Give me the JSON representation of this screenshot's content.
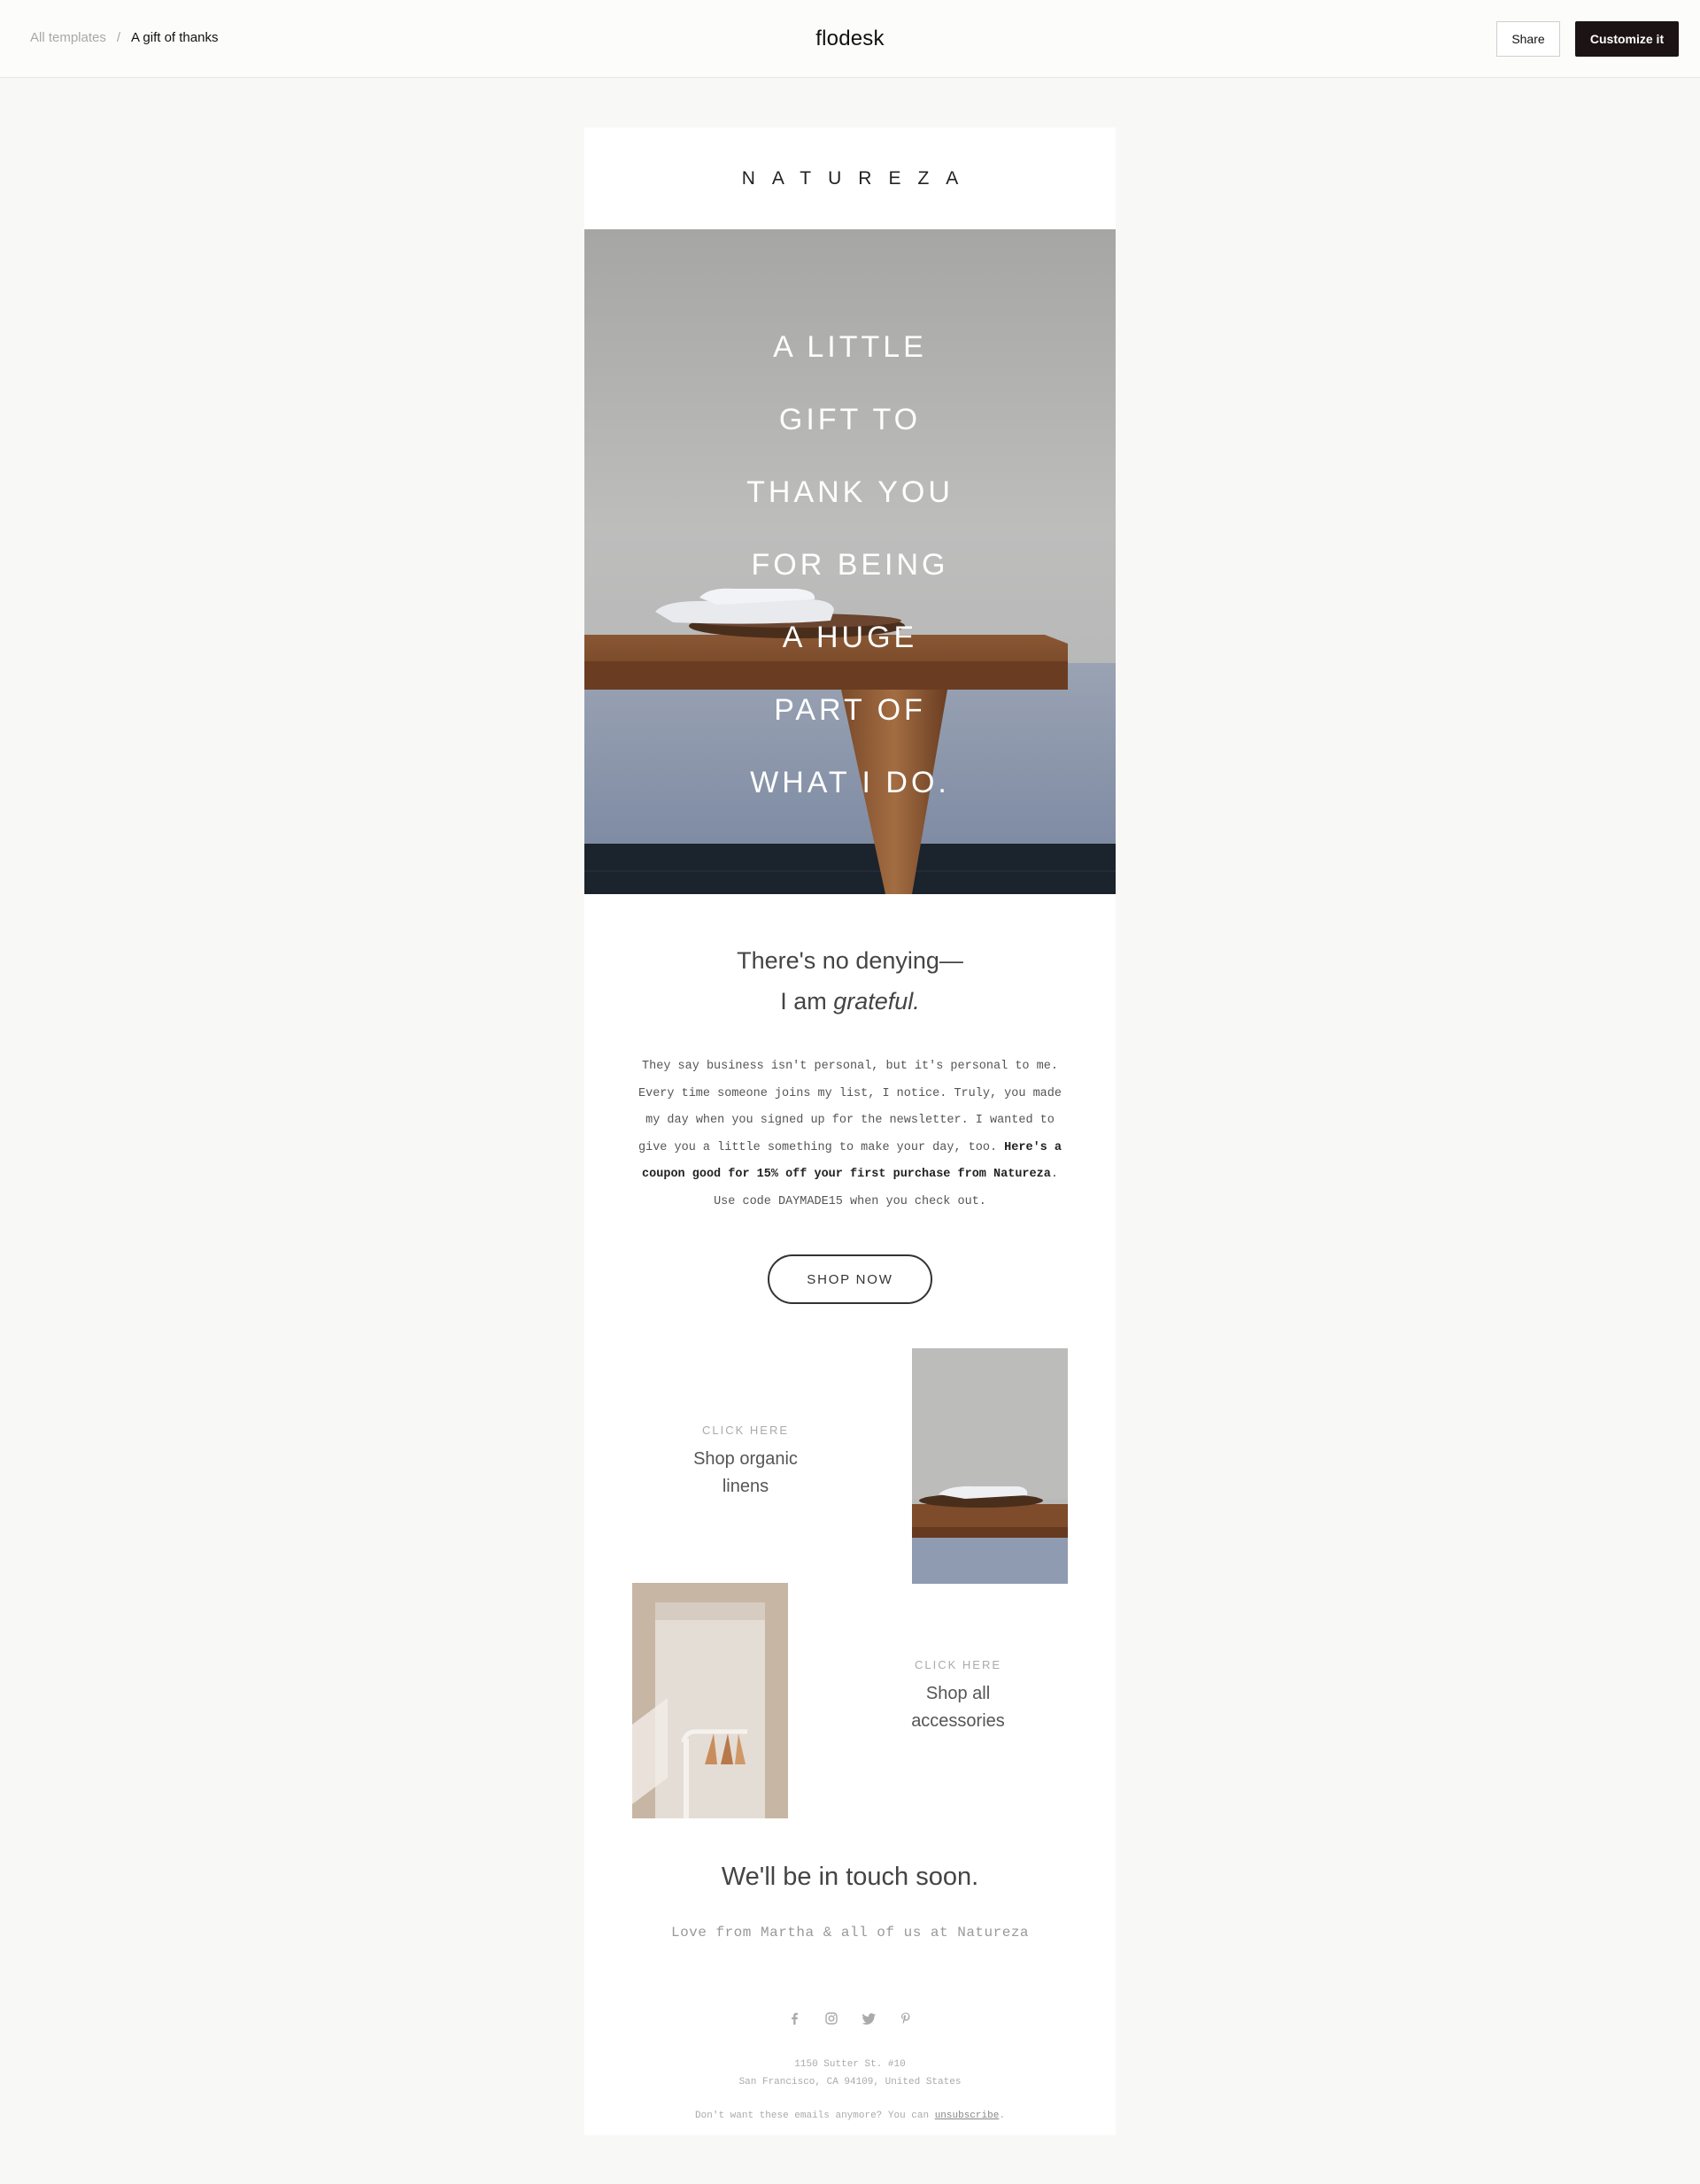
{
  "header": {
    "breadcrumb_root": "All templates",
    "breadcrumb_separator": "/",
    "breadcrumb_current": "A gift of thanks",
    "brand": "flodesk",
    "share_label": "Share",
    "customize_label": "Customize it"
  },
  "email": {
    "logo": "NATUREZA",
    "hero_lines": [
      "A LITTLE",
      "GIFT TO",
      "THANK YOU",
      "FOR BEING",
      "A HUGE",
      "PART OF",
      "WHAT I DO."
    ],
    "headline_line1": "There's no denying—",
    "headline_line2_prefix": "I am ",
    "headline_line2_emphasis": "grateful.",
    "body_intro": "They say business isn't personal, but it's personal to me. Every time someone joins my list, I notice. Truly, you made my day when you signed up for the newsletter. I wanted to give you a little something to make your day, too. ",
    "body_bold": "Here's a coupon good for 15% off your first purchase from Natureza",
    "body_bold_end": ".",
    "body_outro": "Use code DAYMADE15 when you check out.",
    "cta_label": "SHOP NOW",
    "tile1": {
      "eyebrow": "CLICK HERE",
      "title_line1": "Shop organic",
      "title_line2": "linens"
    },
    "tile2": {
      "eyebrow": "CLICK HERE",
      "title_line1": "Shop all",
      "title_line2": "accessories"
    },
    "signoff": "We'll be in touch soon.",
    "signoff_sub": "Love from Martha & all of us at Natureza",
    "social_icons": [
      "facebook-icon",
      "instagram-icon",
      "twitter-icon",
      "pinterest-icon"
    ],
    "address_line1": "1150 Sutter St. #10",
    "address_line2": "San Francisco, CA 94109, United States",
    "unsub_text": "Don't want these emails anymore? You can ",
    "unsub_link": "unsubscribe",
    "unsub_end": "."
  }
}
